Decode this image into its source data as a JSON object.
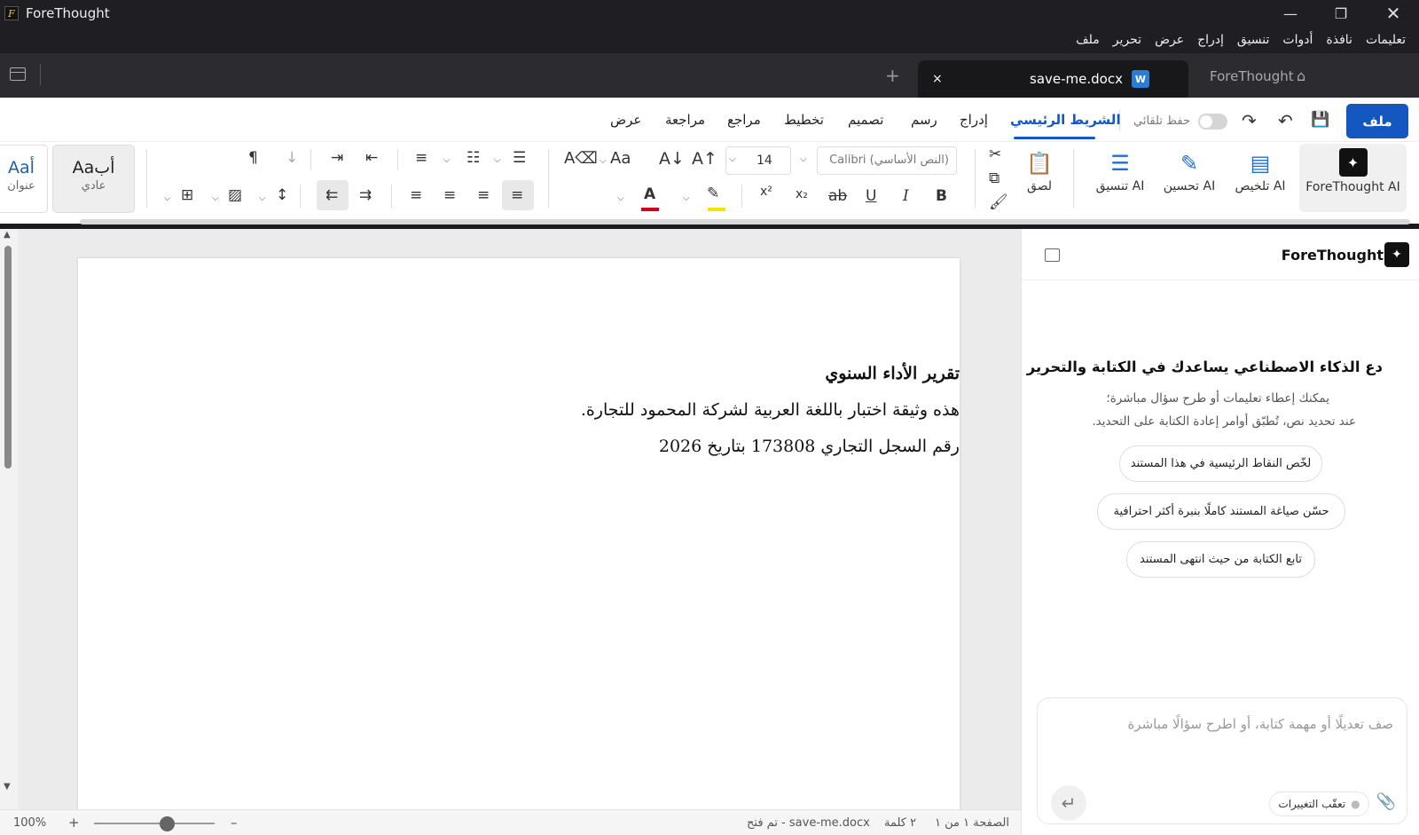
{
  "app": {
    "title": "ForeThought"
  },
  "menu": [
    "ملف",
    "تحرير",
    "عرض",
    "إدراج",
    "تنسيق",
    "أدوات",
    "نافذة",
    "تعليمات"
  ],
  "tabs": {
    "active_doc": "save-me.docx",
    "doc_badge": "W",
    "home": "ForeThought",
    "new_tab": "+",
    "close": "×"
  },
  "ribbon_tabs": {
    "file": "ملف",
    "home": "الشريط الرئيسي",
    "insert": "إدراج",
    "draw": "رسم",
    "design": "تصميم",
    "layout": "تخطيط",
    "references": "مراجع",
    "review": "مراجعة",
    "view": "عرض"
  },
  "autosave": {
    "label": "حفظ تلقائي",
    "on": false
  },
  "ai_buttons": {
    "main": "ForeThought AI",
    "summarize": "تلخيص AI",
    "improve": "تحسين AI",
    "format": "تنسيق AI"
  },
  "clipboard": {
    "paste": "لصق"
  },
  "font": {
    "name": "Calibri (النص الأساسي)",
    "size": "14"
  },
  "styles": [
    {
      "sample": "Aaأب",
      "label": "عادي"
    },
    {
      "sample": "Aaأ",
      "label": "عنوان"
    }
  ],
  "colors": {
    "accent": "#1557c0",
    "font_color": "#d0021b",
    "highlight": "#f5e400"
  },
  "document": {
    "lines": [
      "تقرير الأداء السنوي",
      "هذه وثيقة اختبار باللغة العربية لشركة المحمود للتجارة.",
      "رقم السجل التجاري 173808 بتاريخ 2026"
    ]
  },
  "status": {
    "page": "الصفحة ١ من ١",
    "words": "٢ كلمة",
    "opened": "save-me.docx - تم فتح",
    "zoom": "100%",
    "zoom_in": "+",
    "zoom_out": "–",
    "zoom_level": 0.6
  },
  "panel": {
    "title": "ForeThought",
    "heading": "دع الذكاء الاصطناعي يساعدك في الكتابة والتحرير",
    "sub1": "يمكنك إعطاء تعليمات أو طرح سؤال مباشرة؛",
    "sub2": "عند تحديد نص، تُطبّق أوامر إعادة الكتابة على التحديد.",
    "suggestions": [
      "لخّص النقاط الرئيسية في هذا المستند",
      "حسّن صياغة المستند كاملًا بنبرة أكثر احترافية",
      "تابع الكتابة من حيث انتهى المستند"
    ],
    "input_placeholder": "صف تعديلًا أو مهمة كتابة، أو اطرح سؤالًا مباشرة",
    "track_changes": "تعقّب التغييرات"
  }
}
